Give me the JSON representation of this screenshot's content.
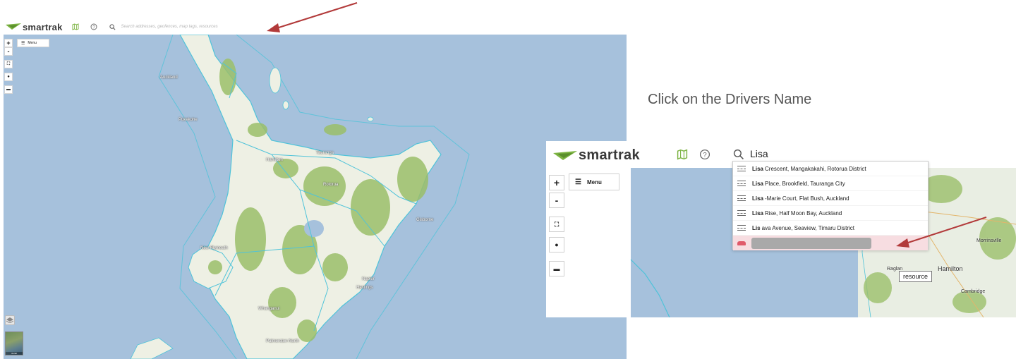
{
  "instruction": "Click on the Drivers Name",
  "left_screen": {
    "app_name": "smartrak",
    "search_placeholder": "Search addresses, geofences, map tags, resources",
    "menu_label": "Menu",
    "zoom_in": "+",
    "zoom_out": "-",
    "aerial_label": "Aerial",
    "places": [
      "Auckland",
      "Pukekohe",
      "Hamilton",
      "Tauranga",
      "Rotorua",
      "New Plymouth",
      "Gisborne",
      "Napier",
      "Hastings",
      "Whanganui",
      "Palmerston North"
    ]
  },
  "right_screen": {
    "app_name": "smartrak",
    "search_value": "Lisa",
    "menu_label": "Menu",
    "zoom_in": "+",
    "zoom_out": "-",
    "results": [
      {
        "bold": "Lisa",
        "rest": " Crescent, Mangakakahi, Rotorua District"
      },
      {
        "bold": "Lisa",
        "rest": " Place, Brookfield, Tauranga City"
      },
      {
        "bold": "Lisa",
        "rest": "-Marie Court, Flat Bush, Auckland"
      },
      {
        "bold": "Lisa",
        "rest": " Rise, Half Moon Bay, Auckland"
      },
      {
        "bold": "Lis",
        "rest": "ava Avenue, Seaview, Timaru District"
      }
    ],
    "tooltip": "resource",
    "places": [
      "Hamilton",
      "Cambridge",
      "Morrinsville",
      "Raglan"
    ]
  },
  "colors": {
    "sea": "#a6c1dc",
    "land": "#eef0e4",
    "forest": "#9bbf6a",
    "boundary": "#4fc3d9",
    "arrow": "#b23a3a",
    "logo_green": "#7cb342"
  }
}
